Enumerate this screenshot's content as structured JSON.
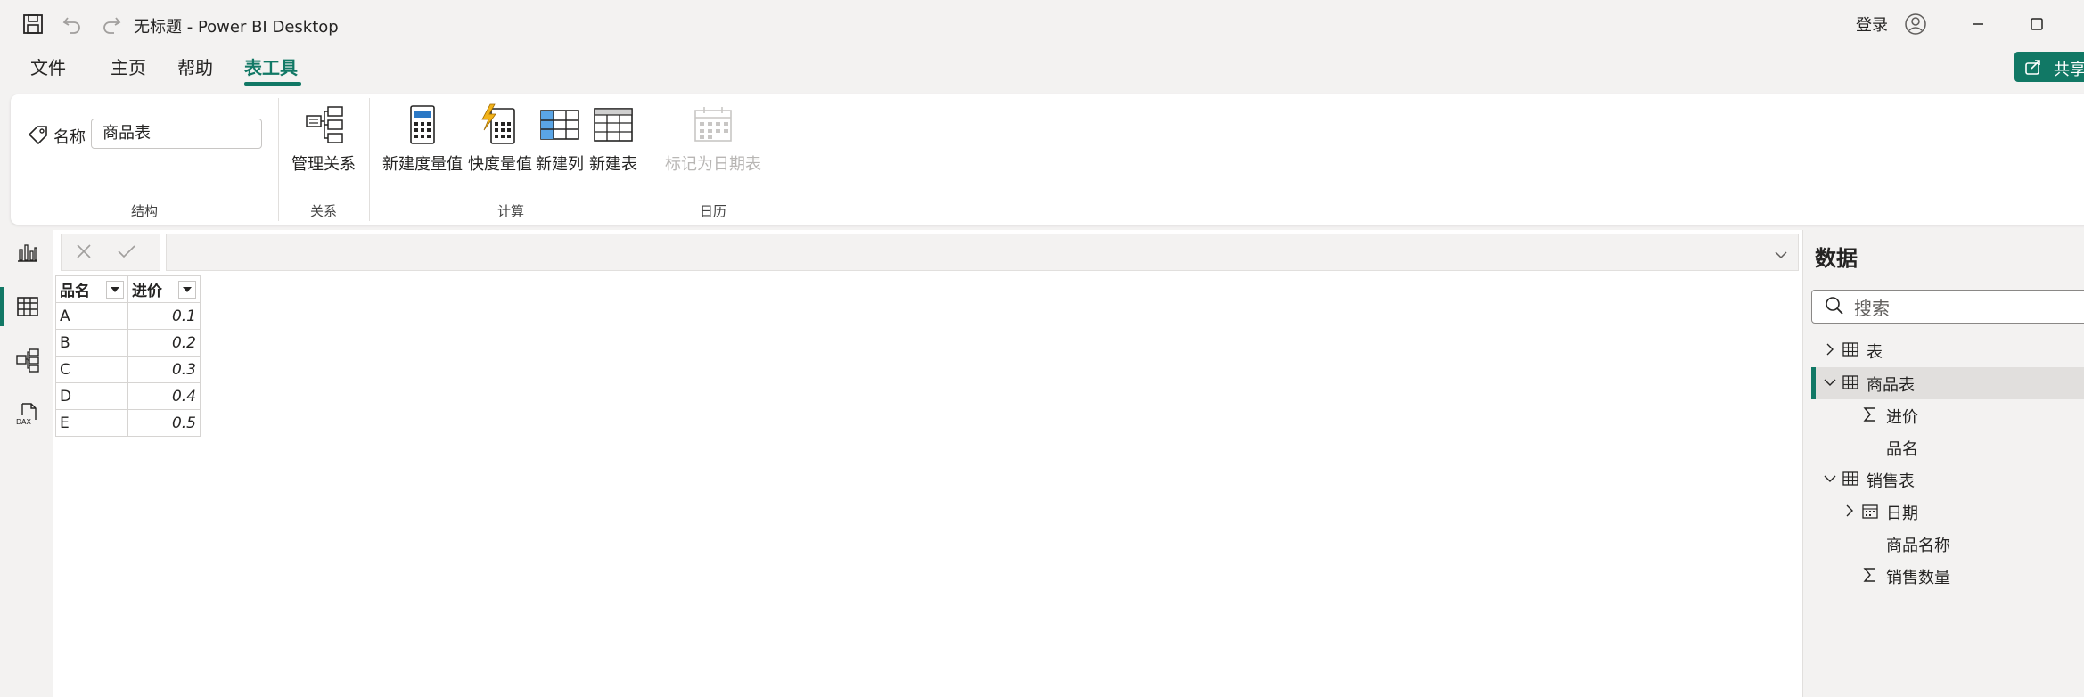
{
  "window": {
    "title": "无标题 - Power BI Desktop",
    "signin_label": "登录"
  },
  "menu": {
    "tabs": [
      {
        "label": "文件"
      },
      {
        "label": "主页"
      },
      {
        "label": "帮助"
      },
      {
        "label": "表工具",
        "active": true
      }
    ],
    "share_label": "共享"
  },
  "ribbon": {
    "structure": {
      "name_label": "名称",
      "name_value": "商品表",
      "group_label": "结构"
    },
    "relationships": {
      "manage_label": "管理关系",
      "group_label": "关系"
    },
    "calculations": {
      "new_measure_label": "新建度量值",
      "quick_measure_label": "快度量值",
      "new_column_label": "新建列",
      "new_table_label": "新建表",
      "group_label": "计算"
    },
    "calendar": {
      "mark_as_date_table_label": "标记为日期表",
      "group_label": "日历"
    }
  },
  "table": {
    "columns": [
      "品名",
      "进价"
    ],
    "rows": [
      {
        "name": "A",
        "price": "0.1"
      },
      {
        "name": "B",
        "price": "0.2"
      },
      {
        "name": "C",
        "price": "0.3"
      },
      {
        "name": "D",
        "price": "0.4"
      },
      {
        "name": "E",
        "price": "0.5"
      }
    ]
  },
  "data_pane": {
    "title": "数据",
    "search_placeholder": "搜索",
    "tree": {
      "table1": "表",
      "products_table": "商品表",
      "products_fields": [
        "进价",
        "品名"
      ],
      "sales_table": "销售表",
      "sales_fields": [
        "日期",
        "商品名称",
        "销售数量"
      ]
    }
  },
  "colors": {
    "accent": "#117865",
    "background": "#f3f2f1"
  }
}
